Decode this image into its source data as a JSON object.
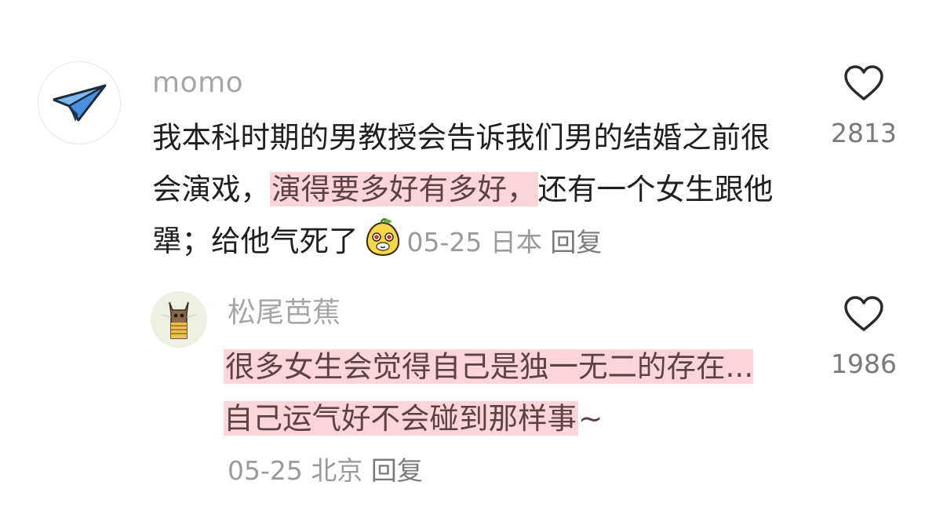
{
  "comment": {
    "avatar_icon": "paper-plane-icon",
    "username": "momo",
    "text_part1": "我本科时期的男教授会告诉我们男的结婚之前很会演戏，",
    "text_highlight": "演得要多好有多好，",
    "text_part2": "还有一个女生跟他犟；给他气死了",
    "emoji": "yellow-pear-face-emoji",
    "date": "05-25",
    "location": "日本",
    "reply_label": "回复",
    "likes": "2813"
  },
  "reply": {
    "avatar_icon": "cat-avatar",
    "username": "松尾芭蕉",
    "text_highlight": "很多女生会觉得自己是独一无二的存在...自己运气好不会碰到那样事",
    "text_suffix": "~",
    "date": "05-25",
    "location": "北京",
    "reply_label": "回复",
    "likes": "1986"
  },
  "colors": {
    "highlight_bg": "#fcd5db",
    "highlight_text": "#5c4246",
    "meta_text": "#9a9a9a",
    "plane_blue": "#4a90e2"
  }
}
